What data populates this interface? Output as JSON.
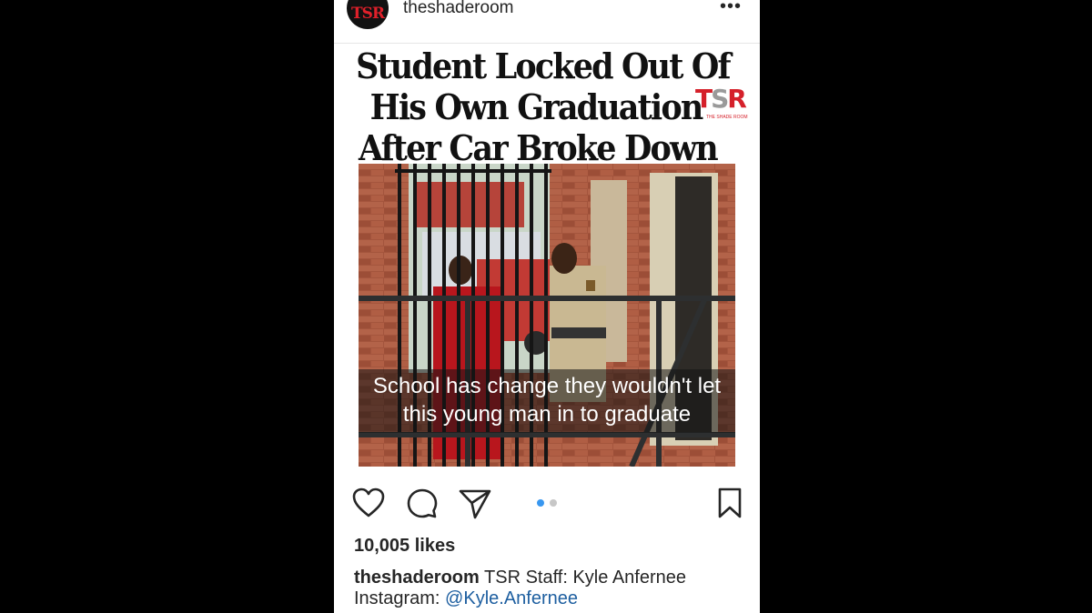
{
  "post": {
    "username": "theshaderoom",
    "avatar_text": "TSR",
    "more_icon": "•••",
    "headline": [
      "Student Locked Out Of",
      "His Own Graduation",
      "After Car Broke Down"
    ],
    "logo": {
      "t": "T",
      "s": "S",
      "r": "R",
      "tagline": "THE SHADE ROOM"
    },
    "photo_caption": [
      "School has change they wouldn't let",
      "this young man in to graduate"
    ],
    "carousel": {
      "total": 2,
      "active": 1,
      "active_color": "#3897f0",
      "inactive_color": "#c7c7c7"
    }
  },
  "actions": {
    "like_icon": "heart-icon",
    "comment_icon": "comment-icon",
    "share_icon": "send-icon",
    "save_icon": "bookmark-icon"
  },
  "likes": "10,005 likes",
  "caption": {
    "user": "theshaderoom",
    "text": "TSR Staff: Kyle Anfernee",
    "line2_prefix": "Instagram: ",
    "mention": "@Kyle.Anfernee"
  },
  "colors": {
    "background": "#000000",
    "brand_red": "#d5202a",
    "link": "#1e5fa0"
  }
}
